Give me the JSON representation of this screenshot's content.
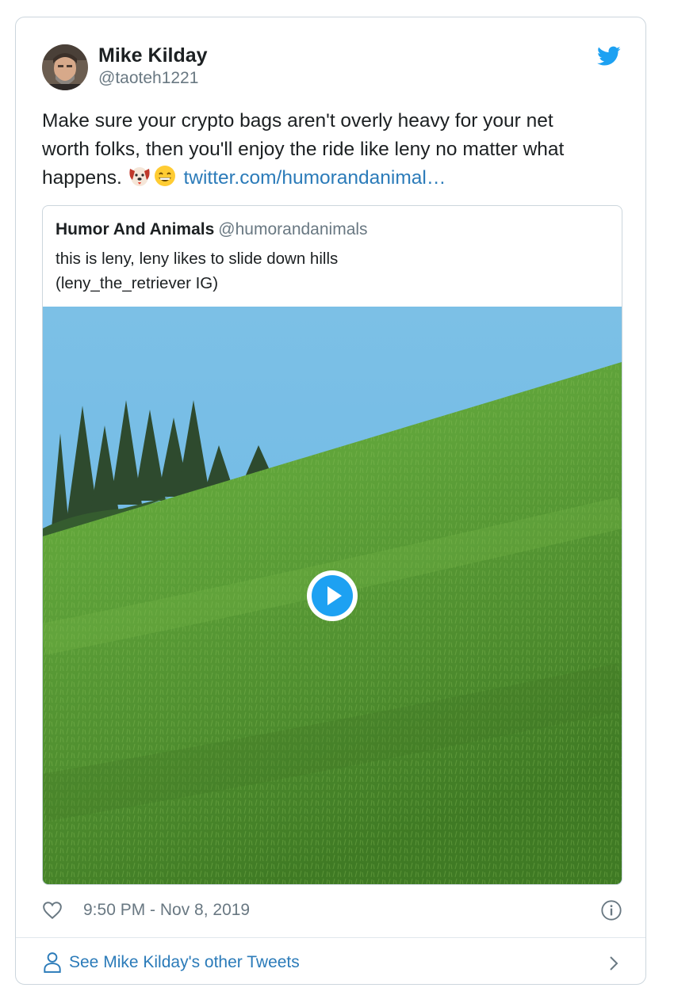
{
  "author": {
    "name": "Mike Kilday",
    "handle": "@taoteh1221"
  },
  "tweet": {
    "line1": "Make sure your crypto bags aren't overly heavy for your net",
    "line2": "worth folks, then you'll enjoy the ride like leny no matter what",
    "line3_prefix": "happens. ",
    "emoji": [
      "dog-face-emoji",
      "grinning-face-emoji"
    ],
    "link": "twitter.com/humorandanimal…"
  },
  "quoted": {
    "name": "Humor And Animals",
    "handle": "@humorandanimals",
    "text_line1": "this is leny, leny likes to slide down hills",
    "text_line2": "(leny_the_retriever IG)"
  },
  "footer": {
    "timestamp": "9:50 PM - Nov 8, 2019",
    "other_tweets": "See Mike Kilday's other Tweets"
  },
  "colors": {
    "link": "#2b7bb9",
    "twitter_blue": "#1da1f2",
    "secondary_text": "#697882",
    "border": "#ccd6dd"
  },
  "icons": [
    "twitter-bird-icon",
    "heart-icon",
    "info-icon",
    "person-icon",
    "chevron-right-icon",
    "play-icon"
  ]
}
